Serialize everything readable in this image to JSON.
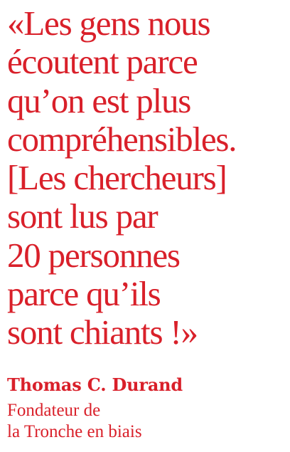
{
  "quote": {
    "lines": [
      "«Les gens nous",
      "écoutent parce",
      "qu’on est plus",
      "compréhensibles.",
      "[Les chercheurs]",
      "sont lus par",
      "20 personnes",
      "parce qu’ils",
      "sont chiants !»"
    ]
  },
  "author": {
    "name": "Thomas C. Durand",
    "role_lines": [
      "Fondateur de",
      "la Tronche en biais"
    ]
  },
  "colors": {
    "accent": "#d9202a",
    "background": "#ffffff"
  }
}
